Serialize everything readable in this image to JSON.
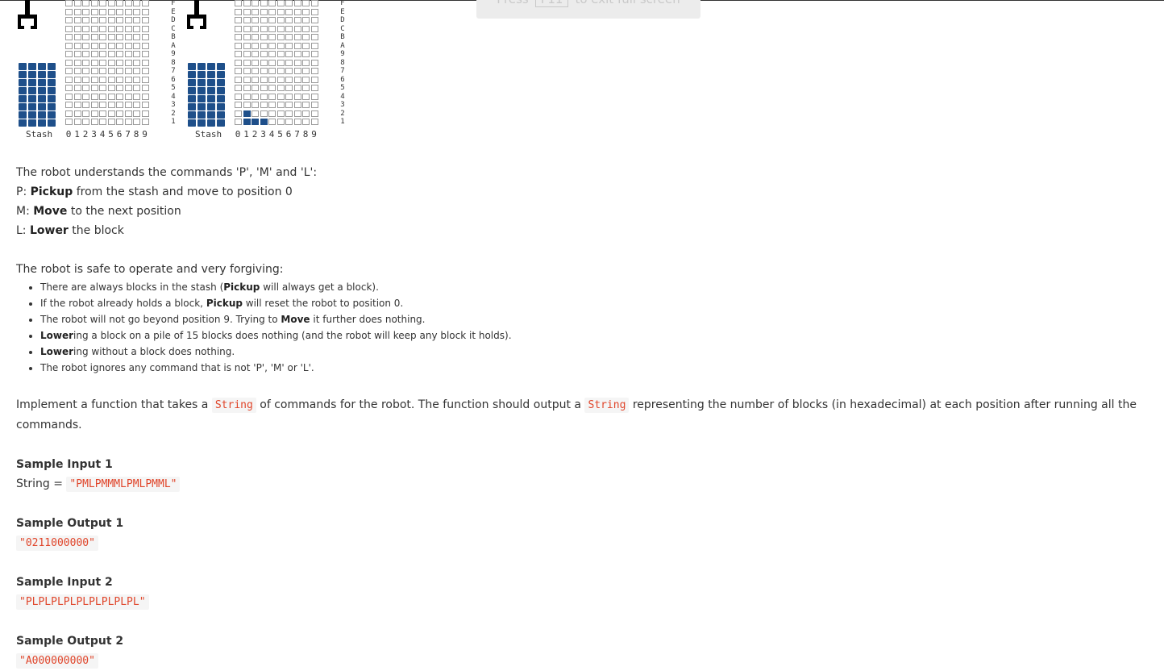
{
  "banner": {
    "prefix": "Press",
    "key": "F11",
    "suffix": "to exit full screen"
  },
  "diagram": {
    "stash_label": "Stash",
    "column_labels": [
      "0",
      "1",
      "2",
      "3",
      "4",
      "5",
      "6",
      "7",
      "8",
      "9"
    ],
    "row_labels": [
      "F",
      "E",
      "D",
      "C",
      "B",
      "A",
      "9",
      "8",
      "7",
      "6",
      "5",
      "4",
      "3",
      "2",
      "1"
    ],
    "before_counts": [
      0,
      0,
      0,
      0,
      0,
      0,
      0,
      0,
      0,
      0
    ],
    "after_counts": [
      0,
      2,
      1,
      1,
      0,
      0,
      0,
      0,
      0,
      0
    ],
    "block_color": "#1e4f8a"
  },
  "intro": {
    "line1": "The robot understands the commands 'P', 'M' and 'L':",
    "p_prefix": "P: ",
    "p_bold": "Pickup",
    "p_rest": " from the stash and move to position 0",
    "m_prefix": "M: ",
    "m_bold": "Move",
    "m_rest": " to the next position",
    "l_prefix": "L: ",
    "l_bold": "Lower",
    "l_rest": " the block"
  },
  "rules": {
    "heading": "The robot is safe to operate and very forgiving:",
    "b1_a": "There are always blocks in the stash (",
    "b1_b": "Pickup",
    "b1_c": " will always get a block).",
    "b2_a": "If the robot already holds a block, ",
    "b2_b": "Pickup",
    "b2_c": " will reset the robot to position 0.",
    "b3_a": "The robot will not go beyond position 9. Trying to ",
    "b3_b": "Move",
    "b3_c": " it further does nothing.",
    "b4_b": "Lower",
    "b4_c": "ing a block on a pile of 15 blocks does nothing (and the robot will keep any block it holds).",
    "b5_b": "Lower",
    "b5_c": "ing without a block does nothing.",
    "b6": "The robot ignores any command that is not 'P', 'M' or 'L'."
  },
  "task": {
    "a": "Implement a function that takes a ",
    "code1": "String",
    "b": " of commands for the robot. The function should output a ",
    "code2": "String",
    "c": " representing the number of blocks (in hexadecimal) at each position after running all the commands."
  },
  "samples": {
    "in1_title": "Sample Input 1",
    "in1_prefix": "String = ",
    "in1_value": "\"PMLPMMMLPMLPMML\"",
    "out1_title": "Sample Output 1",
    "out1_value": "\"0211000000\"",
    "in2_title": "Sample Input 2",
    "in2_value": "\"PLPLPLPLPLPLPLPLPL\"",
    "out2_title": "Sample Output 2",
    "out2_value": "\"A000000000\""
  }
}
